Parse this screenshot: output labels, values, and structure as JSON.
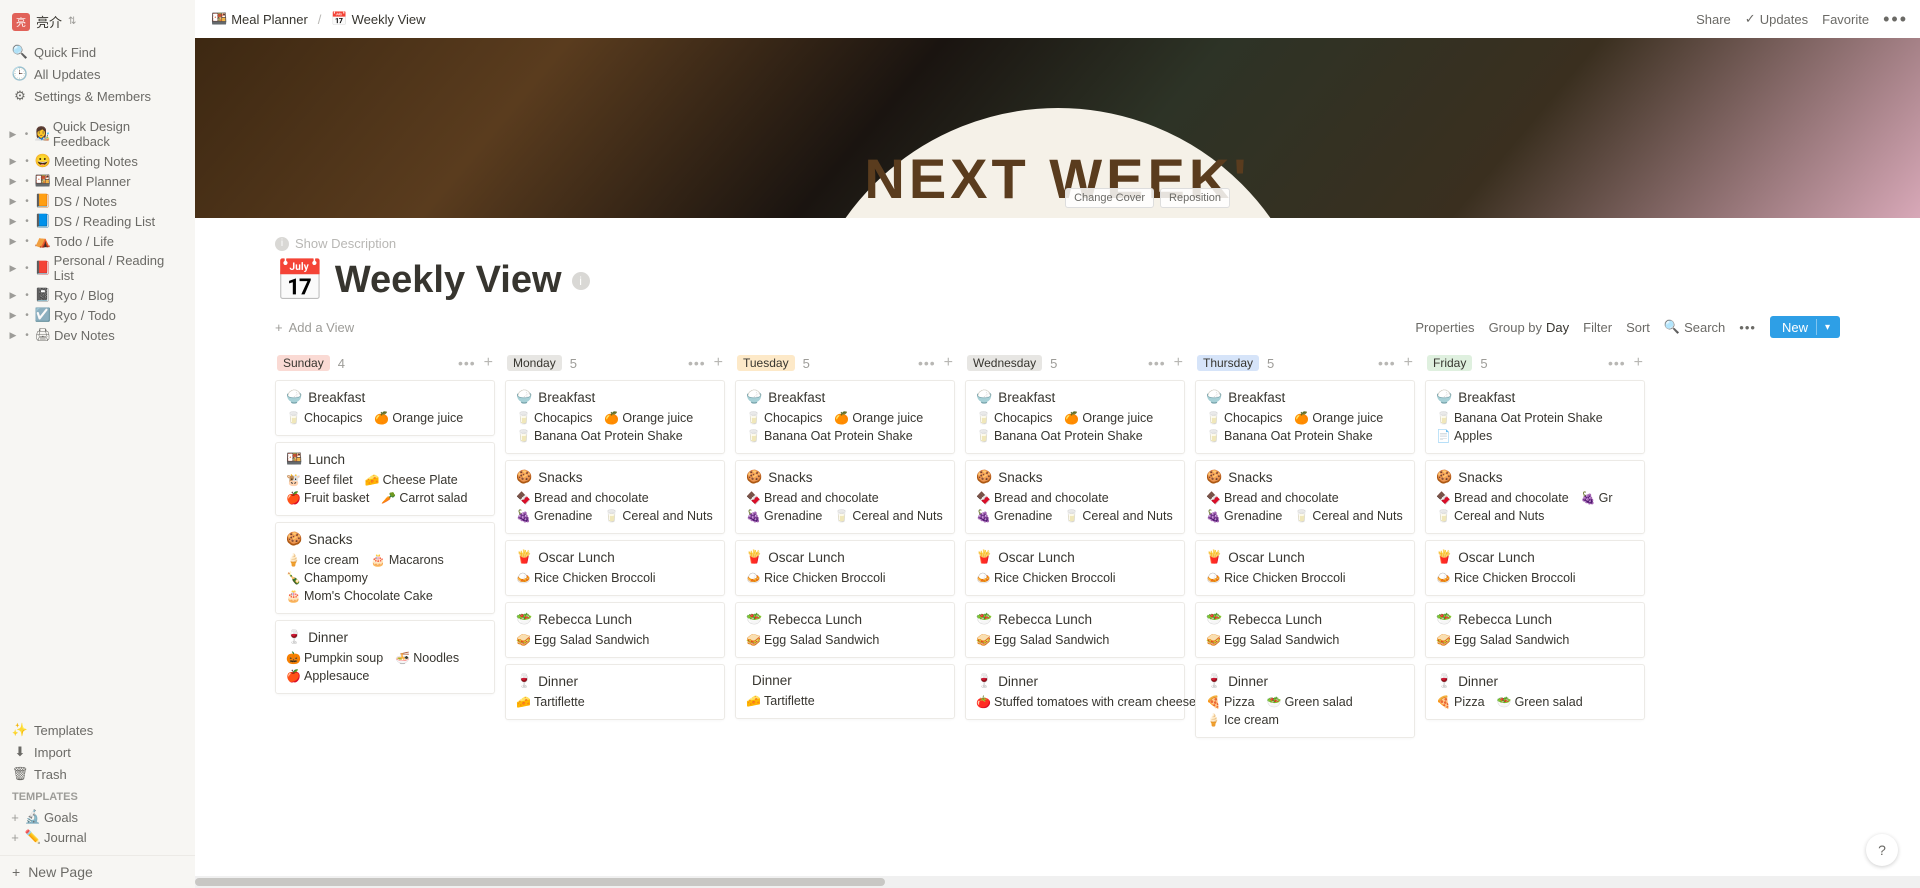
{
  "user": {
    "name": "亮介",
    "avatar_initial": "亮"
  },
  "sidebar_top": [
    {
      "icon": "🔍",
      "label": "Quick Find"
    },
    {
      "icon": "🕒",
      "label": "All Updates"
    },
    {
      "icon": "⚙",
      "label": "Settings & Members"
    }
  ],
  "pages": [
    {
      "icon": "👩‍🎨",
      "label": "Quick Design Feedback"
    },
    {
      "icon": "😀",
      "label": "Meeting Notes"
    },
    {
      "icon": "🍱",
      "label": "Meal Planner"
    },
    {
      "icon": "📙",
      "label": "DS / Notes"
    },
    {
      "icon": "📘",
      "label": "DS / Reading List"
    },
    {
      "icon": "⛺",
      "label": "Todo / Life"
    },
    {
      "icon": "📕",
      "label": "Personal / Reading List"
    },
    {
      "icon": "📓",
      "label": "Ryo / Blog"
    },
    {
      "icon": "☑️",
      "label": "Ryo / Todo"
    },
    {
      "icon": "🖨",
      "label": "Dev Notes"
    }
  ],
  "sidebar_bottom": [
    {
      "icon": "✨",
      "label": "Templates"
    },
    {
      "icon": "⬇",
      "label": "Import"
    },
    {
      "icon": "🗑",
      "label": "Trash"
    }
  ],
  "templates_heading": "TEMPLATES",
  "template_pages": [
    {
      "icon": "🔬",
      "label": "Goals"
    },
    {
      "icon": "✏️",
      "label": "Journal"
    }
  ],
  "new_page_label": "New Page",
  "breadcrumb": [
    {
      "icon": "🍱",
      "label": "Meal Planner"
    },
    {
      "icon": "📅",
      "label": "Weekly View"
    }
  ],
  "topbar_right": {
    "share": "Share",
    "updates": "Updates",
    "favorite": "Favorite"
  },
  "cover": {
    "text": "NEXT WEEK'",
    "change": "Change Cover",
    "reposition": "Reposition"
  },
  "show_description": "Show Description",
  "page_title": "Weekly View",
  "page_icon": "📅",
  "add_view": "Add a View",
  "view_controls": {
    "properties": "Properties",
    "group_by_prefix": "Group by ",
    "group_by_value": "Day",
    "filter": "Filter",
    "sort": "Sort",
    "search": "Search",
    "new": "New"
  },
  "day_colors": {
    "Sunday": {
      "bg": "#fadad4",
      "fg": "#37352f"
    },
    "Monday": {
      "bg": "#e7e6e3",
      "fg": "#37352f"
    },
    "Tuesday": {
      "bg": "#fde9c8",
      "fg": "#37352f"
    },
    "Wednesday": {
      "bg": "#e7e6e3",
      "fg": "#37352f"
    },
    "Thursday": {
      "bg": "#d6e4f9",
      "fg": "#37352f"
    },
    "Friday": {
      "bg": "#dff0df",
      "fg": "#37352f"
    }
  },
  "board": [
    {
      "day": "Sunday",
      "count": 4,
      "cards": [
        {
          "icon": "🍚",
          "title": "Breakfast",
          "items": [
            {
              "icon": "🥛",
              "label": "Chocapics"
            },
            {
              "icon": "🍊",
              "label": "Orange juice"
            }
          ]
        },
        {
          "icon": "🍱",
          "title": "Lunch",
          "items": [
            {
              "icon": "🐮",
              "label": "Beef filet"
            },
            {
              "icon": "🧀",
              "label": "Cheese Plate"
            },
            {
              "icon": "🍎",
              "label": "Fruit basket"
            },
            {
              "icon": "🥕",
              "label": "Carrot salad"
            }
          ]
        },
        {
          "icon": "🍪",
          "title": "Snacks",
          "items": [
            {
              "icon": "🍦",
              "label": "Ice cream"
            },
            {
              "icon": "🎂",
              "label": "Macarons"
            },
            {
              "icon": "🍾",
              "label": "Champomy"
            },
            {
              "icon": "🎂",
              "label": "Mom's Chocolate Cake"
            }
          ]
        },
        {
          "icon": "🍷",
          "title": "Dinner",
          "items": [
            {
              "icon": "🎃",
              "label": "Pumpkin soup"
            },
            {
              "icon": "🍜",
              "label": "Noodles"
            },
            {
              "icon": "🍎",
              "label": "Applesauce"
            }
          ]
        }
      ]
    },
    {
      "day": "Monday",
      "count": 5,
      "cards": [
        {
          "icon": "🍚",
          "title": "Breakfast",
          "items": [
            {
              "icon": "🥛",
              "label": "Chocapics"
            },
            {
              "icon": "🍊",
              "label": "Orange juice"
            },
            {
              "icon": "🥛",
              "label": "Banana Oat Protein Shake"
            }
          ]
        },
        {
          "icon": "🍪",
          "title": "Snacks",
          "items": [
            {
              "icon": "🍫",
              "label": "Bread and chocolate"
            },
            {
              "icon": "🍇",
              "label": "Grenadine"
            },
            {
              "icon": "🥛",
              "label": "Cereal and Nuts"
            }
          ]
        },
        {
          "icon": "🍟",
          "title": "Oscar Lunch",
          "items": [
            {
              "icon": "🍛",
              "label": "Rice Chicken Broccoli"
            }
          ]
        },
        {
          "icon": "🥗",
          "title": "Rebecca Lunch",
          "items": [
            {
              "icon": "🥪",
              "label": "Egg Salad Sandwich"
            }
          ]
        },
        {
          "icon": "🍷",
          "title": "Dinner",
          "items": [
            {
              "icon": "🧀",
              "label": "Tartiflette"
            }
          ]
        }
      ]
    },
    {
      "day": "Tuesday",
      "count": 5,
      "cards": [
        {
          "icon": "🍚",
          "title": "Breakfast",
          "items": [
            {
              "icon": "🥛",
              "label": "Chocapics"
            },
            {
              "icon": "🍊",
              "label": "Orange juice"
            },
            {
              "icon": "🥛",
              "label": "Banana Oat Protein Shake"
            }
          ]
        },
        {
          "icon": "🍪",
          "title": "Snacks",
          "items": [
            {
              "icon": "🍫",
              "label": "Bread and chocolate"
            },
            {
              "icon": "🍇",
              "label": "Grenadine"
            },
            {
              "icon": "🥛",
              "label": "Cereal and Nuts"
            }
          ]
        },
        {
          "icon": "🍟",
          "title": "Oscar Lunch",
          "items": [
            {
              "icon": "🍛",
              "label": "Rice Chicken Broccoli"
            }
          ]
        },
        {
          "icon": "🥗",
          "title": "Rebecca Lunch",
          "items": [
            {
              "icon": "🥪",
              "label": "Egg Salad Sandwich"
            }
          ]
        },
        {
          "icon": "",
          "title": "Dinner",
          "items": [
            {
              "icon": "🧀",
              "label": "Tartiflette"
            }
          ]
        }
      ]
    },
    {
      "day": "Wednesday",
      "count": 5,
      "cards": [
        {
          "icon": "🍚",
          "title": "Breakfast",
          "items": [
            {
              "icon": "🥛",
              "label": "Chocapics"
            },
            {
              "icon": "🍊",
              "label": "Orange juice"
            },
            {
              "icon": "🥛",
              "label": "Banana Oat Protein Shake"
            }
          ]
        },
        {
          "icon": "🍪",
          "title": "Snacks",
          "items": [
            {
              "icon": "🍫",
              "label": "Bread and chocolate"
            },
            {
              "icon": "🍇",
              "label": "Grenadine"
            },
            {
              "icon": "🥛",
              "label": "Cereal and Nuts"
            }
          ]
        },
        {
          "icon": "🍟",
          "title": "Oscar Lunch",
          "items": [
            {
              "icon": "🍛",
              "label": "Rice Chicken Broccoli"
            }
          ]
        },
        {
          "icon": "🥗",
          "title": "Rebecca Lunch",
          "items": [
            {
              "icon": "🥪",
              "label": "Egg Salad Sandwich"
            }
          ]
        },
        {
          "icon": "🍷",
          "title": "Dinner",
          "items": [
            {
              "icon": "🍅",
              "label": "Stuffed tomatoes with cream cheese"
            }
          ]
        }
      ]
    },
    {
      "day": "Thursday",
      "count": 5,
      "cards": [
        {
          "icon": "🍚",
          "title": "Breakfast",
          "items": [
            {
              "icon": "🥛",
              "label": "Chocapics"
            },
            {
              "icon": "🍊",
              "label": "Orange juice"
            },
            {
              "icon": "🥛",
              "label": "Banana Oat Protein Shake"
            }
          ]
        },
        {
          "icon": "🍪",
          "title": "Snacks",
          "items": [
            {
              "icon": "🍫",
              "label": "Bread and chocolate"
            },
            {
              "icon": "🍇",
              "label": "Grenadine"
            },
            {
              "icon": "🥛",
              "label": "Cereal and Nuts"
            }
          ]
        },
        {
          "icon": "🍟",
          "title": "Oscar Lunch",
          "items": [
            {
              "icon": "🍛",
              "label": "Rice Chicken Broccoli"
            }
          ]
        },
        {
          "icon": "🥗",
          "title": "Rebecca Lunch",
          "items": [
            {
              "icon": "🥪",
              "label": "Egg Salad Sandwich"
            }
          ]
        },
        {
          "icon": "🍷",
          "title": "Dinner",
          "items": [
            {
              "icon": "🍕",
              "label": "Pizza"
            },
            {
              "icon": "🥗",
              "label": "Green salad"
            },
            {
              "icon": "🍦",
              "label": "Ice cream"
            }
          ]
        }
      ]
    },
    {
      "day": "Friday",
      "count": 5,
      "cards": [
        {
          "icon": "🍚",
          "title": "Breakfast",
          "items": [
            {
              "icon": "🥛",
              "label": "Banana Oat Protein Shake"
            },
            {
              "icon": "📄",
              "label": "Apples"
            }
          ]
        },
        {
          "icon": "🍪",
          "title": "Snacks",
          "items": [
            {
              "icon": "🍫",
              "label": "Bread and chocolate"
            },
            {
              "icon": "🍇",
              "label": "Gr"
            },
            {
              "icon": "🥛",
              "label": "Cereal and Nuts"
            }
          ]
        },
        {
          "icon": "🍟",
          "title": "Oscar Lunch",
          "items": [
            {
              "icon": "🍛",
              "label": "Rice Chicken Broccoli"
            }
          ]
        },
        {
          "icon": "🥗",
          "title": "Rebecca Lunch",
          "items": [
            {
              "icon": "🥪",
              "label": "Egg Salad Sandwich"
            }
          ]
        },
        {
          "icon": "🍷",
          "title": "Dinner",
          "items": [
            {
              "icon": "🍕",
              "label": "Pizza"
            },
            {
              "icon": "🥗",
              "label": "Green salad"
            }
          ]
        }
      ]
    }
  ]
}
